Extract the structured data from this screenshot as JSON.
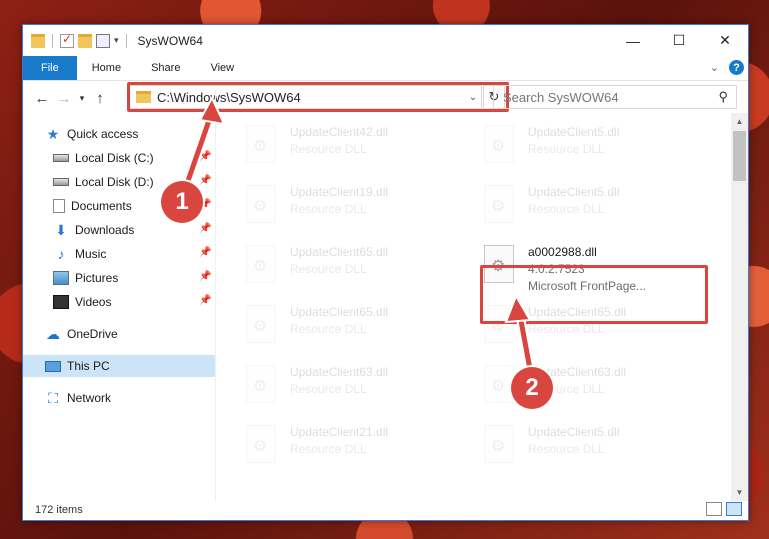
{
  "window": {
    "title": "SysWOW64",
    "controls": {
      "minimize": "—",
      "maximize": "☐",
      "close": "✕"
    }
  },
  "ribbon": {
    "tabs": [
      "File",
      "Home",
      "Share",
      "View"
    ]
  },
  "address": {
    "path": "C:\\Windows\\SysWOW64",
    "search_placeholder": "Search SysWOW64"
  },
  "nav": {
    "items": [
      {
        "label": "Quick access",
        "icon": "star-icon"
      },
      {
        "label": "Local Disk (C:)",
        "icon": "drive-icon",
        "pinned": true
      },
      {
        "label": "Local Disk (D:)",
        "icon": "drive-icon",
        "pinned": true
      },
      {
        "label": "Documents",
        "icon": "documents-icon",
        "pinned": true
      },
      {
        "label": "Downloads",
        "icon": "download-icon",
        "pinned": true
      },
      {
        "label": "Music",
        "icon": "music-icon",
        "pinned": true
      },
      {
        "label": "Pictures",
        "icon": "pictures-icon",
        "pinned": true
      },
      {
        "label": "Videos",
        "icon": "videos-icon",
        "pinned": true
      },
      {
        "label": "OneDrive",
        "icon": "cloud-icon"
      },
      {
        "label": "This PC",
        "icon": "computer-icon",
        "selected": true
      },
      {
        "label": "Network",
        "icon": "network-icon"
      }
    ]
  },
  "files": [
    {
      "name": "UpdateClient42.dll",
      "desc": "Resource DLL"
    },
    {
      "name": "UpdateClient5.dll",
      "desc": "Resource DLL"
    },
    {
      "name": "UpdateClient19.dll",
      "desc": "Resource DLL"
    },
    {
      "name": "UpdateClient5.dll",
      "desc": "Resource DLL"
    },
    {
      "name": "UpdateClient65.dll",
      "desc": "Resource DLL"
    },
    {
      "name": "a0002988.dll",
      "desc": "4.0.2.7523",
      "extra": "Microsoft FrontPage..."
    },
    {
      "name": "UpdateClient65.dll",
      "desc": "Resource DLL"
    },
    {
      "name": "UpdateClient65.dll",
      "desc": "Resource DLL"
    },
    {
      "name": "UpdateClient63.dll",
      "desc": "Resource DLL"
    },
    {
      "name": "UpdateClient63.dll",
      "desc": "Resource DLL"
    },
    {
      "name": "UpdateClient21.dll",
      "desc": "Resource DLL"
    },
    {
      "name": "UpdateClient5.dll",
      "desc": "Resource DLL"
    }
  ],
  "status": {
    "item_count": "172 items"
  },
  "callouts": {
    "one": "1",
    "two": "2"
  },
  "colors": {
    "accent": "#1979ca",
    "highlight": "#d9463f",
    "selected_bg": "#cce4f7"
  }
}
